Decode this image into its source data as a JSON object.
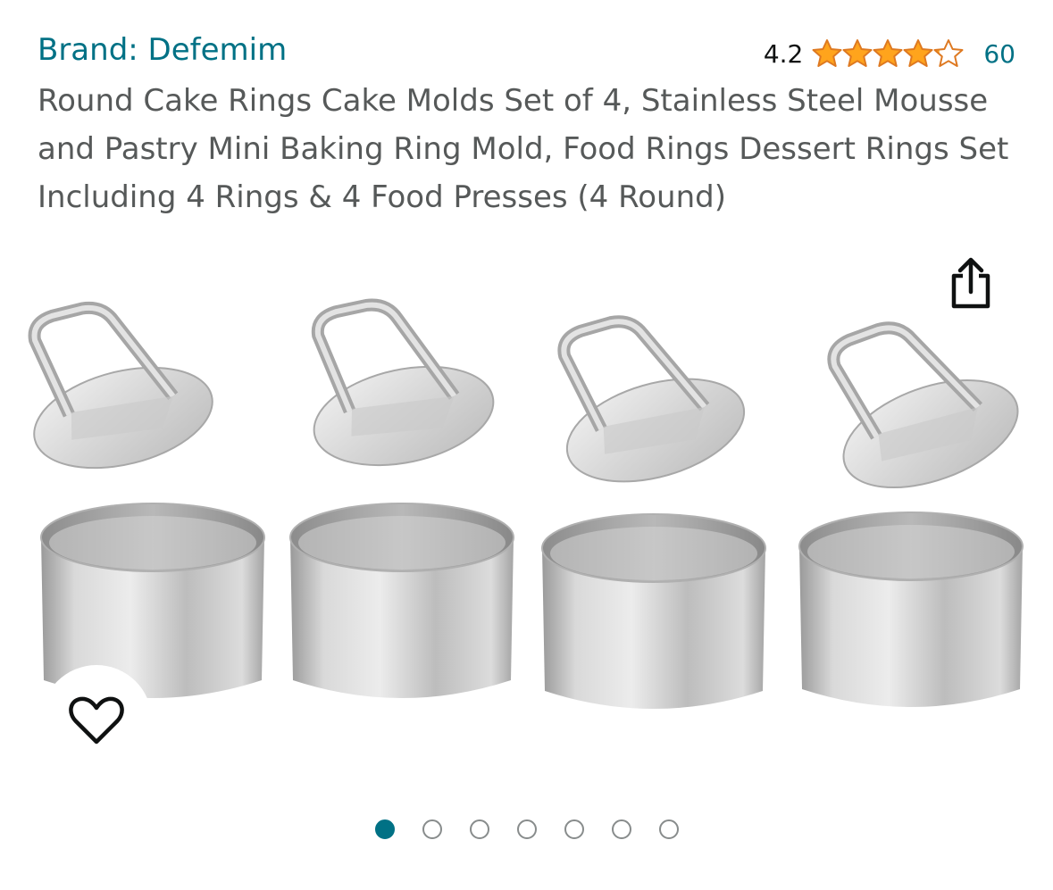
{
  "product": {
    "brand_label": "Brand: Defemim",
    "rating_value": "4.2",
    "rating_stars": 4.2,
    "rating_count": "60",
    "title": "Round Cake Rings Cake Molds Set of 4, Stainless Steel Mousse and Pastry Mini Baking Ring Mold, Food Rings Dessert Rings Set Including 4 Rings & 4 Food Presses (4 Round)"
  },
  "gallery": {
    "image_count": 7,
    "active_index": 0
  },
  "icons": {
    "share": "share-icon",
    "wishlist": "heart-icon",
    "star": "star-icon"
  },
  "colors": {
    "link": "#007185",
    "star": "#ffa41c",
    "title_text": "#565959",
    "dot_inactive": "#888c8c"
  }
}
